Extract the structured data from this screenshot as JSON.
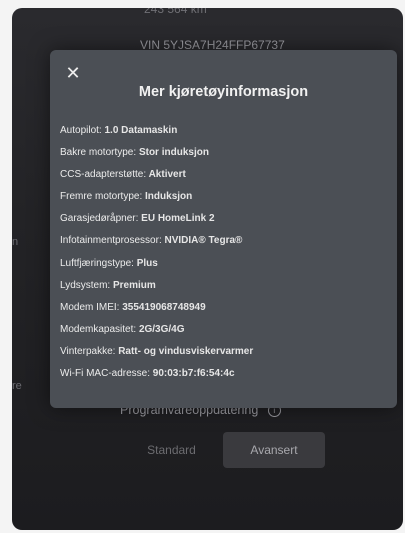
{
  "background": {
    "odometer": "243 564 km",
    "vin": "VIN 5YJSA7H24FFP67737",
    "edge_letters": [
      "n",
      "re"
    ],
    "software_update_label": "Programvareoppdatering",
    "info_icon": "info-icon",
    "buttons": {
      "standard": "Standard",
      "advanced": "Avansert"
    }
  },
  "modal": {
    "close_icon": "close-icon",
    "title": "Mer kjøretøyinformasjon",
    "rows": [
      {
        "label": "Autopilot:",
        "value": "1.0 Datamaskin"
      },
      {
        "label": "Bakre motortype:",
        "value": "Stor induksjon"
      },
      {
        "label": "CCS-adapterstøtte:",
        "value": "Aktivert"
      },
      {
        "label": "Fremre motortype:",
        "value": "Induksjon"
      },
      {
        "label": "Garasjedøråpner:",
        "value": "EU HomeLink 2"
      },
      {
        "label": "Infotainmentprosessor:",
        "value": "NVIDIA® Tegra®"
      },
      {
        "label": "Luftfjæringstype:",
        "value": "Plus"
      },
      {
        "label": "Lydsystem:",
        "value": "Premium"
      },
      {
        "label": "Modem IMEI:",
        "value": "355419068748949"
      },
      {
        "label": "Modemkapasitet:",
        "value": "2G/3G/4G"
      },
      {
        "label": "Vinterpakke:",
        "value": "Ratt- og vindusviskervarmer"
      },
      {
        "label": "Wi-Fi MAC-adresse:",
        "value": "90:03:b7:f6:54:4c"
      }
    ]
  }
}
